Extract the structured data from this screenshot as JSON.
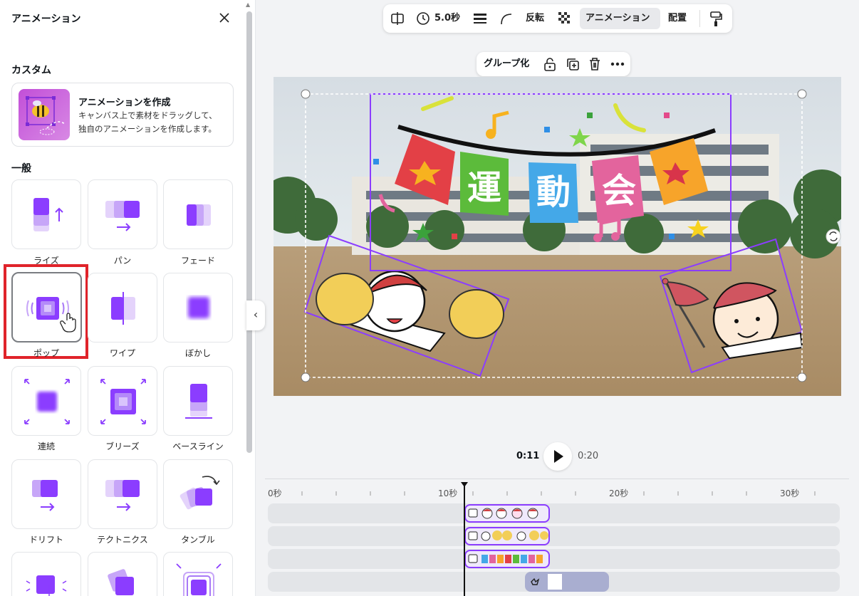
{
  "panel": {
    "title": "アニメーション",
    "custom_section": "カスタム",
    "custom_card": {
      "title": "アニメーションを作成",
      "desc_line1": "キャンバス上で素材をドラッグして、",
      "desc_line2": "独自のアニメーションを作成します。"
    },
    "general_section": "一般",
    "tiles": [
      {
        "label": "ライズ",
        "icon": "rise-icon"
      },
      {
        "label": "パン",
        "icon": "pan-icon"
      },
      {
        "label": "フェード",
        "icon": "fade-icon"
      },
      {
        "label": "ポップ",
        "icon": "pop-icon",
        "selected": true
      },
      {
        "label": "ワイプ",
        "icon": "wipe-icon"
      },
      {
        "label": "ぼかし",
        "icon": "blur-icon"
      },
      {
        "label": "連続",
        "icon": "continuous-icon"
      },
      {
        "label": "ブリーズ",
        "icon": "breathe-icon"
      },
      {
        "label": "ベースライン",
        "icon": "baseline-icon"
      },
      {
        "label": "ドリフト",
        "icon": "drift-icon"
      },
      {
        "label": "テクトニクス",
        "icon": "tectonic-icon"
      },
      {
        "label": "タンブル",
        "icon": "tumble-icon"
      }
    ]
  },
  "toolbar": {
    "duration": "5.0秒",
    "flip": "反転",
    "animation": "アニメーション",
    "position": "配置"
  },
  "group_toolbar": {
    "group_label": "グループ化"
  },
  "canvas": {
    "banner_text": [
      "運",
      "動",
      "会"
    ]
  },
  "timeline": {
    "current_time": "0:11",
    "total_time": "0:20",
    "ruler_labels": [
      "0秒",
      "10秒",
      "20秒",
      "30秒"
    ]
  },
  "colors": {
    "accent": "#8b3dff",
    "highlight": "#e0232a"
  }
}
